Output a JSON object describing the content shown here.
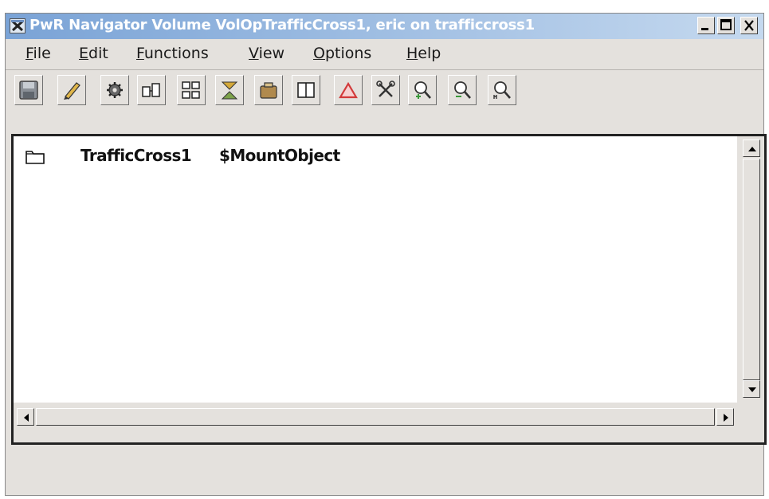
{
  "window": {
    "title": "PwR Navigator Volume VolOpTrafficCross1, eric on trafficcross1",
    "minimize_label": "_",
    "maximize_label": "□",
    "close_label": "X"
  },
  "menu": {
    "items": [
      {
        "mnemonic": "F",
        "rest": "ile"
      },
      {
        "mnemonic": "E",
        "rest": "dit"
      },
      {
        "mnemonic": "F",
        "rest": "unctions"
      },
      {
        "mnemonic": "V",
        "rest": "iew"
      },
      {
        "mnemonic": "O",
        "rest": "ptions"
      },
      {
        "mnemonic": "H",
        "rest": "elp"
      }
    ]
  },
  "toolbar": {
    "buttons": [
      {
        "icon": "save-icon"
      },
      {
        "icon": "edit-pencil-icon"
      },
      {
        "icon": "gear-icon"
      },
      {
        "icon": "object-tree-icon"
      },
      {
        "icon": "hierarchy-icon"
      },
      {
        "icon": "plant-flow-icon"
      },
      {
        "icon": "container-icon"
      },
      {
        "icon": "split-view-icon"
      },
      {
        "icon": "alarm-triangle-icon"
      },
      {
        "icon": "tools-icon"
      },
      {
        "icon": "zoom-in-icon"
      },
      {
        "icon": "zoom-out-icon"
      },
      {
        "icon": "zoom-reset-icon"
      }
    ]
  },
  "navigator": {
    "rows": [
      {
        "icon": "folder-icon",
        "name": "TrafficCross1",
        "class": "$MountObject"
      }
    ]
  },
  "colors": {
    "titlebar_start": "#7aa3d6",
    "titlebar_end": "#c5d9ef",
    "window_bg": "#e4e1dd",
    "list_bg": "#ffffff",
    "alarm_red": "#d23a3a"
  }
}
